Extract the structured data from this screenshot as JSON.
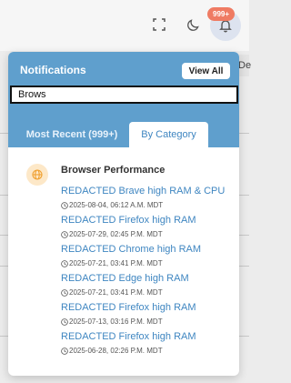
{
  "header": {
    "notification_badge": "999+",
    "bell_bg": "#dde3ef",
    "badge_color": "#ef7b63"
  },
  "background_fragment": "De",
  "notifications": {
    "title": "Notifications",
    "view_all_label": "View All",
    "search_value": "Brows",
    "tabs": [
      {
        "label": "Most Recent (999+)",
        "active": false
      },
      {
        "label": "By Category",
        "active": true
      }
    ],
    "accent": "#5f9fcd",
    "group": {
      "icon": "globe-icon",
      "title": "Browser Performance",
      "items": [
        {
          "title": "REDACTED Brave high RAM & CPU",
          "time": "2025-08-04, 06:12 A.M. MDT"
        },
        {
          "title": "REDACTED Firefox high RAM",
          "time": "2025-07-29, 02:45 P.M. MDT"
        },
        {
          "title": "REDACTED Chrome high RAM",
          "time": "2025-07-21, 03:41 P.M. MDT"
        },
        {
          "title": "REDACTED Edge high RAM",
          "time": "2025-07-21, 03:41 P.M. MDT"
        },
        {
          "title": "REDACTED Firefox high RAM",
          "time": "2025-07-13, 03:16 P.M. MDT"
        },
        {
          "title": "REDACTED Firefox high RAM",
          "time": "2025-06-28, 02:26 P.M. MDT"
        }
      ]
    }
  }
}
